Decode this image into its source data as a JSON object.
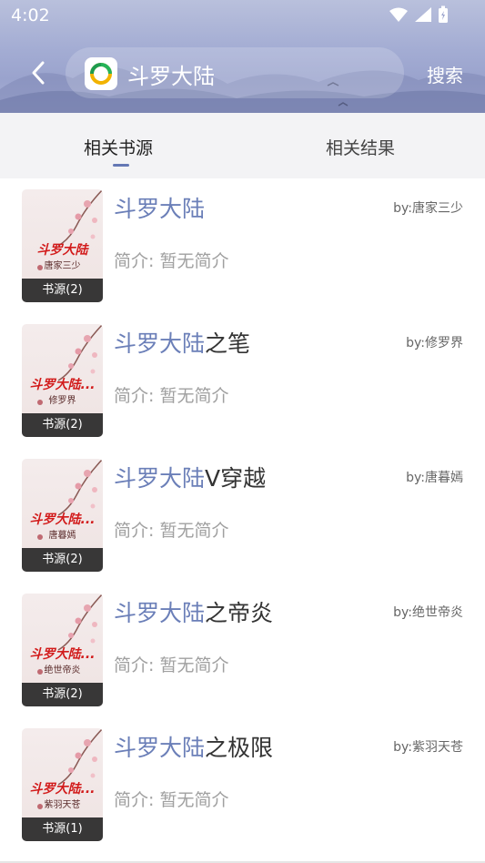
{
  "status_bar": {
    "time": "4:02"
  },
  "header": {
    "back_icon": "chevron-left-icon",
    "app_logo_icon": "app-logo-icon",
    "search_query": "斗罗大陆",
    "search_button": "搜索"
  },
  "tabs": [
    {
      "label": "相关书源",
      "active": true
    },
    {
      "label": "相关结果",
      "active": false
    }
  ],
  "accent_color": "#6b7fb8",
  "books": [
    {
      "title_highlight": "斗罗大陆",
      "title_rest": "",
      "author": "by:唐家三少",
      "intro": "简介: 暂无简介",
      "cover_title": "斗罗大陆",
      "cover_author": "唐家三少",
      "sources": "书源(2)"
    },
    {
      "title_highlight": "斗罗大陆",
      "title_rest": "之笔",
      "author": "by:修罗界",
      "intro": "简介: 暂无简介",
      "cover_title": "斗罗大陆...",
      "cover_author": "修罗界",
      "sources": "书源(2)"
    },
    {
      "title_highlight": "斗罗大陆",
      "title_rest": "V穿越",
      "author": "by:唐暮嫣",
      "intro": "简介: 暂无简介",
      "cover_title": "斗罗大陆...",
      "cover_author": "唐暮嫣",
      "sources": "书源(2)"
    },
    {
      "title_highlight": "斗罗大陆",
      "title_rest": "之帝炎",
      "author": "by:绝世帝炎",
      "intro": "简介: 暂无简介",
      "cover_title": "斗罗大陆...",
      "cover_author": "绝世帝炎",
      "sources": "书源(2)"
    },
    {
      "title_highlight": "斗罗大陆",
      "title_rest": "之极限",
      "author": "by:紫羽天苍",
      "intro": "简介: 暂无简介",
      "cover_title": "斗罗大陆...",
      "cover_author": "紫羽天苍",
      "sources": "书源(1)"
    }
  ]
}
